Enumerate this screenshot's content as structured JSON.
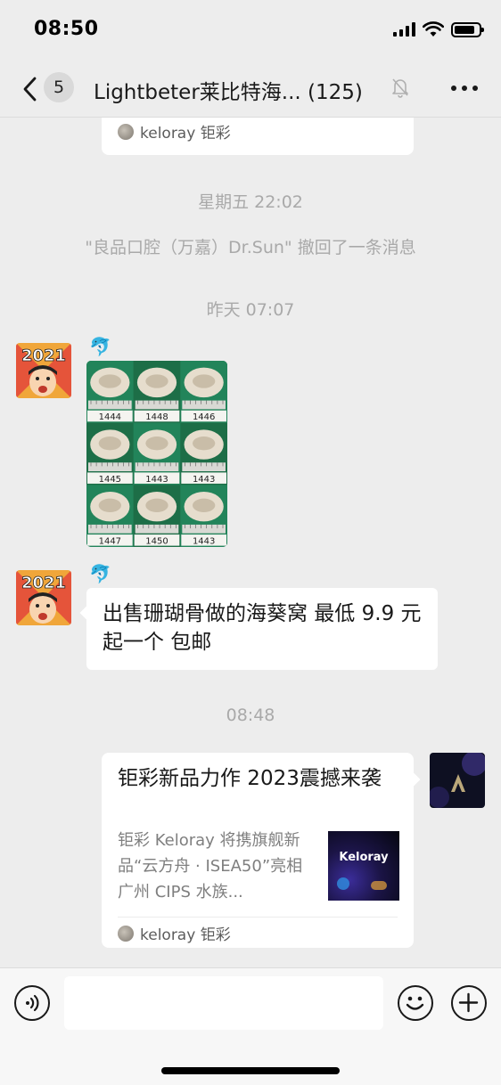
{
  "status_bar": {
    "time": "08:50",
    "battery_level": 0.85
  },
  "nav": {
    "unread_count": "5",
    "title": "Lightbeter莱比特海...  (125)",
    "icons": [
      "chevron-left-icon",
      "mute-bell-icon",
      "more-icon"
    ]
  },
  "messages": {
    "top_card": {
      "source": "keloray 钜彩"
    },
    "time_1": "星期五 22:02",
    "recall_notice": "\"良品口腔（万嘉）Dr.Sun\" 撤回了一条消息",
    "time_2": "昨天 07:07",
    "sender_emoji": "🐬",
    "photo": {
      "labels": [
        "1444",
        "1448",
        "1446",
        "1445",
        "1443",
        "1443",
        "1447",
        "1450",
        "1443"
      ]
    },
    "text_message": "出售珊瑚骨做的海葵窝 最低 9.9 元起一个 包邮",
    "time_3": "08:48",
    "article_card": {
      "title": "钜彩新品力作 2023震撼来袭",
      "description": "钜彩 Keloray 将携旗舰新品“云方舟 · ISEA50”亮相广州 CIPS 水族...",
      "thumb_text": "Keloray",
      "source": "keloray 钜彩"
    }
  },
  "input_bar": {
    "placeholder": "",
    "icons": [
      "voice-icon",
      "emoji-icon",
      "plus-icon"
    ]
  },
  "colors": {
    "background": "#ededed",
    "card": "#ffffff",
    "muted_text": "#a9a9a9"
  }
}
